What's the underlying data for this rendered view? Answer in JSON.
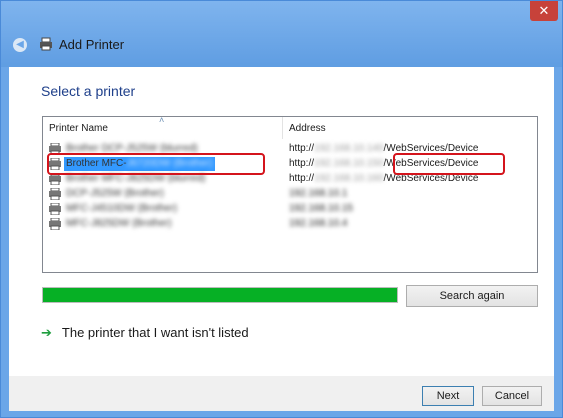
{
  "window": {
    "title": "Add Printer",
    "close_glyph": "✕",
    "back_glyph": "◀"
  },
  "heading": "Select a printer",
  "columns": {
    "name": "Printer Name",
    "address": "Address",
    "sort_glyph": "˄"
  },
  "printers": [
    {
      "name": "Brother DCP-J525W (blurred)",
      "addr_prefix": "http://",
      "addr_blur": "192.168.10.140",
      "addr_suffix": "/WebServices/Device",
      "selected": false
    },
    {
      "name_prefix": "Brother MFC-",
      "name_blur": "J6720DW (Brother)",
      "addr_prefix": "http://",
      "addr_blur": "192.168.10.150",
      "addr_suffix": "/WebServices/Device",
      "selected": true
    },
    {
      "name": "Brother MFC-J825DW (blurred)",
      "addr_prefix": "http://",
      "addr_blur": "192.168.10.160",
      "addr_suffix": "/WebServices/Device",
      "selected": false
    },
    {
      "name": "DCP-J525W (Brother)",
      "addr": "192.168.10.1",
      "selected": false
    },
    {
      "name": "MFC-J4510DW (Brother)",
      "addr": "192.168.10.15",
      "selected": false
    },
    {
      "name": "MFC-J825DW (Brother)",
      "addr": "192.168.10.4",
      "selected": false
    }
  ],
  "progress": {
    "percent": 100,
    "color": "#06b025"
  },
  "buttons": {
    "search_again": "Search again",
    "next": "Next",
    "cancel": "Cancel"
  },
  "not_listed": {
    "arrow": "➔",
    "label": "The printer that I want isn't listed"
  },
  "icons": {
    "printer": "printer-icon",
    "back": "back-arrow-icon",
    "close": "close-icon",
    "link_arrow": "green-arrow-icon"
  },
  "colors": {
    "selection": "#3399ff",
    "highlight_box": "#d4141c",
    "heading": "#1e3f8a",
    "titlebar": "#6ba6e8"
  }
}
